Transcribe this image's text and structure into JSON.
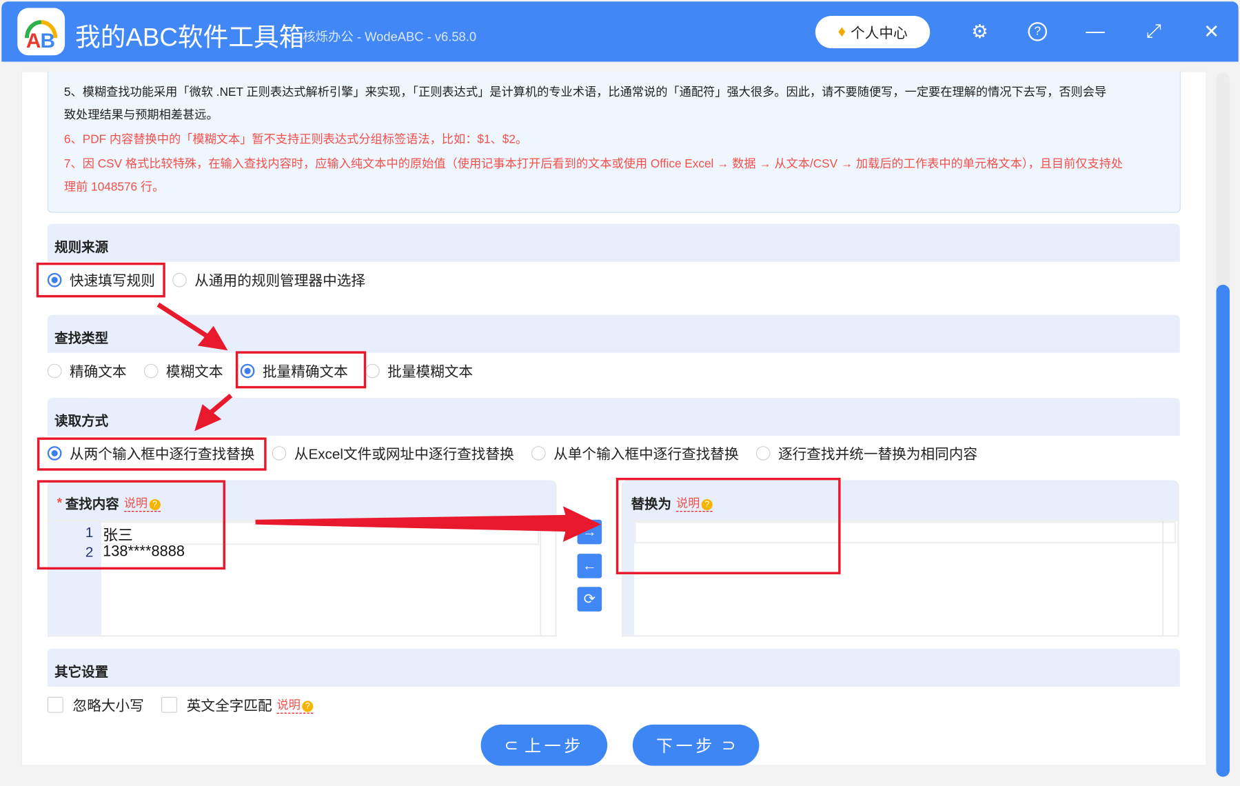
{
  "app": {
    "title": "我的ABC软件工具箱",
    "subtitle": "核烁办公 - WodeABC - v6.58.0",
    "user_center": "个人中心",
    "logo_text": "AB"
  },
  "notice": {
    "lines": [
      "5、模糊查找功能采用「微软 .NET 正则表达式解析引擎」来实现，「正则表达式」是计算机的专业术语，比通常说的「通配符」强大很多。因此，请不要随便写，一定要在理解的情况下去写，否则会导",
      "致处理结果与预期相差甚远。",
      "6、PDF 内容替换中的「模糊文本」暂不支持正则表达式分组标签语法，比如：$1、$2。",
      "7、因 CSV 格式比较特殊，在输入查找内容时，应输入纯文本中的原始值（使用记事本打开后看到的文本或使用 Office Excel → 数据 → 从文本/CSV → 加载后的工作表中的单元格文本），且目前仅支持处",
      "理前 1048576 行。"
    ]
  },
  "rule_source": {
    "title": "规则来源",
    "options": [
      "快速填写规则",
      "从通用的规则管理器中选择"
    ],
    "selected": 0
  },
  "find_type": {
    "title": "查找类型",
    "options": [
      "精确文本",
      "模糊文本",
      "批量精确文本",
      "批量模糊文本"
    ],
    "selected": 2
  },
  "read_mode": {
    "title": "读取方式",
    "options": [
      "从两个输入框中逐行查找替换",
      "从Excel文件或网址中逐行查找替换",
      "从单个输入框中逐行查找替换",
      "逐行查找并统一替换为相同内容"
    ],
    "selected": 0
  },
  "find_panel": {
    "required": "*",
    "title": "查找内容",
    "hint": "说明",
    "lines": [
      {
        "n": "1",
        "text": "张三"
      },
      {
        "n": "2",
        "text": "138****8888"
      }
    ]
  },
  "replace_panel": {
    "title": "替换为",
    "hint": "说明"
  },
  "other": {
    "title": "其它设置",
    "ignore_case": "忽略大小写",
    "whole_word": "英文全字匹配",
    "hint": "说明"
  },
  "nav": {
    "prev": "上一步",
    "next": "下一步"
  }
}
